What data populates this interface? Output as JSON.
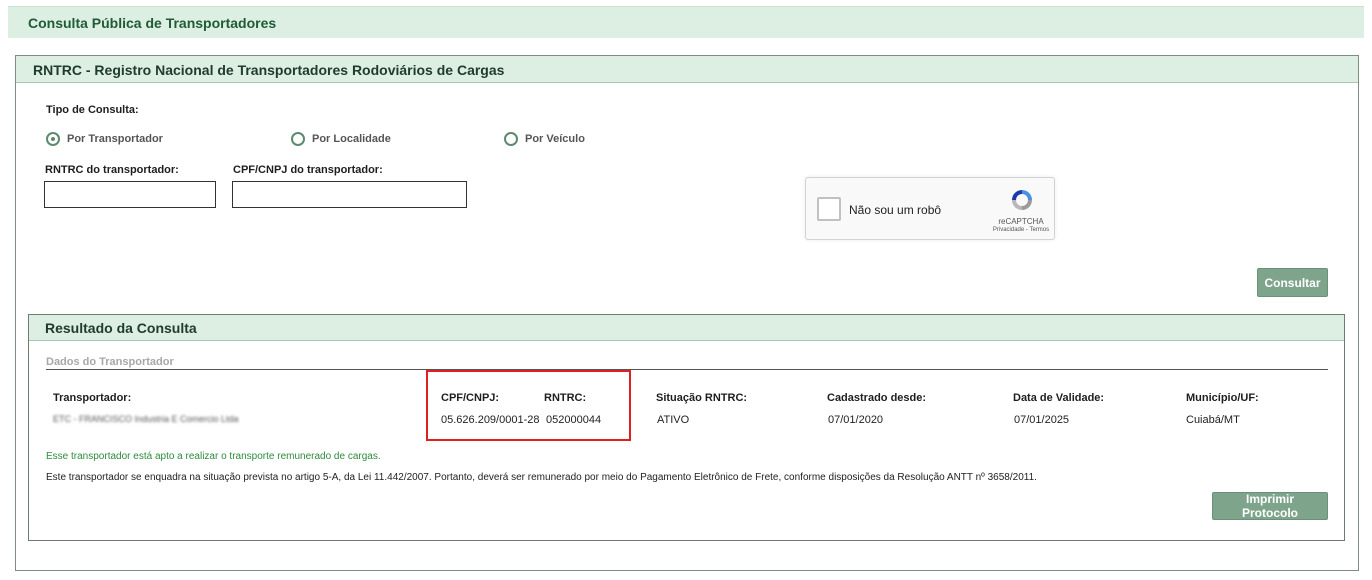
{
  "page": {
    "title": "Consulta Pública de Transportadores"
  },
  "form": {
    "section_title": "RNTRC - Registro Nacional de Transportadores Rodoviários de Cargas",
    "tipo_label": "Tipo de Consulta:",
    "radios": [
      {
        "label": "Por Transportador",
        "checked": true
      },
      {
        "label": "Por Localidade",
        "checked": false
      },
      {
        "label": "Por Veículo",
        "checked": false
      }
    ],
    "rntrc_label": "RNTRC do transportador:",
    "rntrc_value": "",
    "cpf_label": "CPF/CNPJ do transportador:",
    "cpf_value": "",
    "captcha": {
      "label": "Não sou um robô",
      "brand": "reCAPTCHA",
      "links": "Privacidade - Termos"
    },
    "submit_label": "Consultar"
  },
  "result": {
    "title": "Resultado da Consulta",
    "subsection": "Dados do Transportador",
    "headers": {
      "transportador": "Transportador:",
      "cpf": "CPF/CNPJ:",
      "rntrc": "RNTRC:",
      "situacao": "Situação RNTRC:",
      "cadastrado": "Cadastrado desde:",
      "validade": "Data de Validade:",
      "municipio": "Município/UF:"
    },
    "values": {
      "transportador": "ETC - FRANCISCO Industria E Comercio Ltda",
      "cpf": "05.626.209/0001-28",
      "rntrc": "052000044",
      "situacao": "ATIVO",
      "cadastrado": "07/01/2020",
      "validade": "07/01/2025",
      "municipio": "Cuiabá/MT"
    },
    "message_apto": "Esse transportador está apto a realizar o transporte remunerado de cargas.",
    "message_lei": "Este transportador se enquadra na situação prevista no artigo 5-A, da Lei 11.442/2007. Portanto, deverá ser remunerado por meio do Pagamento Eletrônico de Frete, conforme disposições da Resolução ANTT nº 3658/2011.",
    "print_label": "Imprimir Protocolo"
  }
}
